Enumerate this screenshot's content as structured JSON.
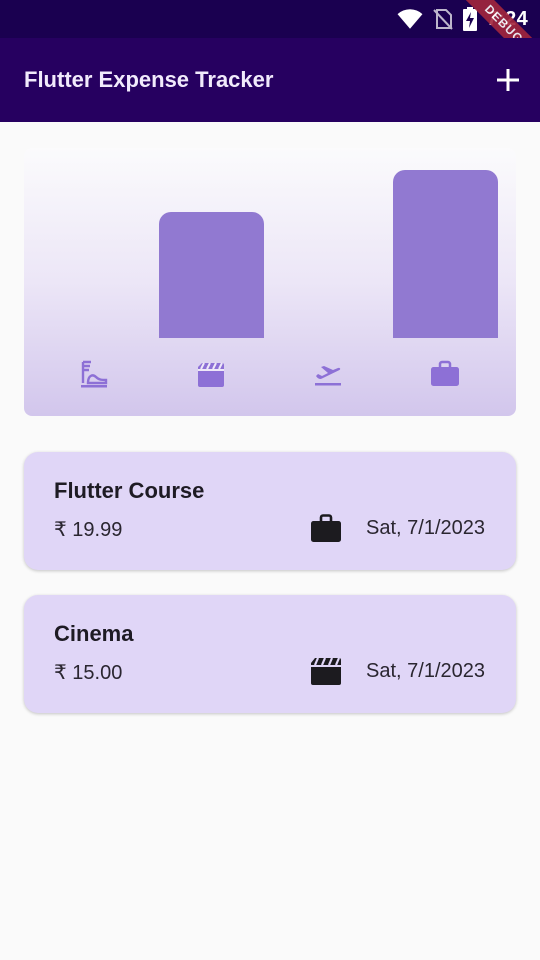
{
  "status_bar": {
    "time": "7:24",
    "debug_label": "DEBUG"
  },
  "app_bar": {
    "title": "Flutter Expense Tracker",
    "add_icon": "plus-icon"
  },
  "chart_data": {
    "type": "bar",
    "categories": [
      "food",
      "leisure",
      "travel",
      "work"
    ],
    "values": [
      0,
      15.0,
      0,
      19.99
    ],
    "icons": [
      "lunch-dining-icon",
      "movie-icon",
      "flight-takeoff-icon",
      "work-icon"
    ],
    "bar_color": "#9179d1"
  },
  "expenses": [
    {
      "title": "Flutter Course",
      "amount": "₹ 19.99",
      "category_icon": "work-icon",
      "date": "Sat, 7/1/2023"
    },
    {
      "title": "Cinema",
      "amount": "₹ 15.00",
      "category_icon": "movie-icon",
      "date": "Sat, 7/1/2023"
    }
  ],
  "colors": {
    "app_bar": "#260060",
    "status_bar": "#1a0050",
    "card": "#e0d6f7",
    "accent": "#8d70d6"
  }
}
